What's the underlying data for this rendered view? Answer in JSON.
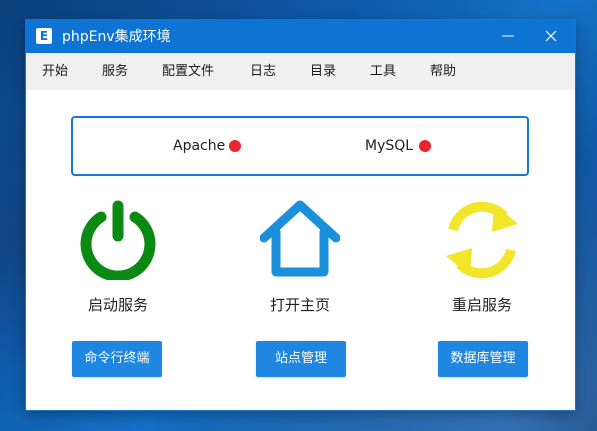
{
  "window": {
    "title": "phpEnv集成环境",
    "icon_letter": "E",
    "minimize_label": "",
    "close_label": ""
  },
  "menu": {
    "items": [
      {
        "label": "开始"
      },
      {
        "label": "服务"
      },
      {
        "label": "配置文件"
      },
      {
        "label": "日志"
      },
      {
        "label": "目录"
      },
      {
        "label": "工具"
      },
      {
        "label": "帮助"
      }
    ]
  },
  "status": {
    "services": [
      {
        "name": "Apache",
        "state_color": "#e8262b"
      },
      {
        "name": "MySQL",
        "state_color": "#e8262b"
      }
    ]
  },
  "actions": {
    "start": {
      "label": "启动服务",
      "icon": "power-icon",
      "color": "#0a8a12"
    },
    "home": {
      "label": "打开主页",
      "icon": "home-icon",
      "color": "#1a8fdc"
    },
    "restart": {
      "label": "重启服务",
      "icon": "refresh-icon",
      "color": "#f3e52a"
    }
  },
  "buttons": {
    "terminal": "命令行终端",
    "sites": "站点管理",
    "database": "数据库管理"
  },
  "colors": {
    "accent": "#0e74d4",
    "button": "#1f86e2",
    "border": "#1779d6"
  }
}
